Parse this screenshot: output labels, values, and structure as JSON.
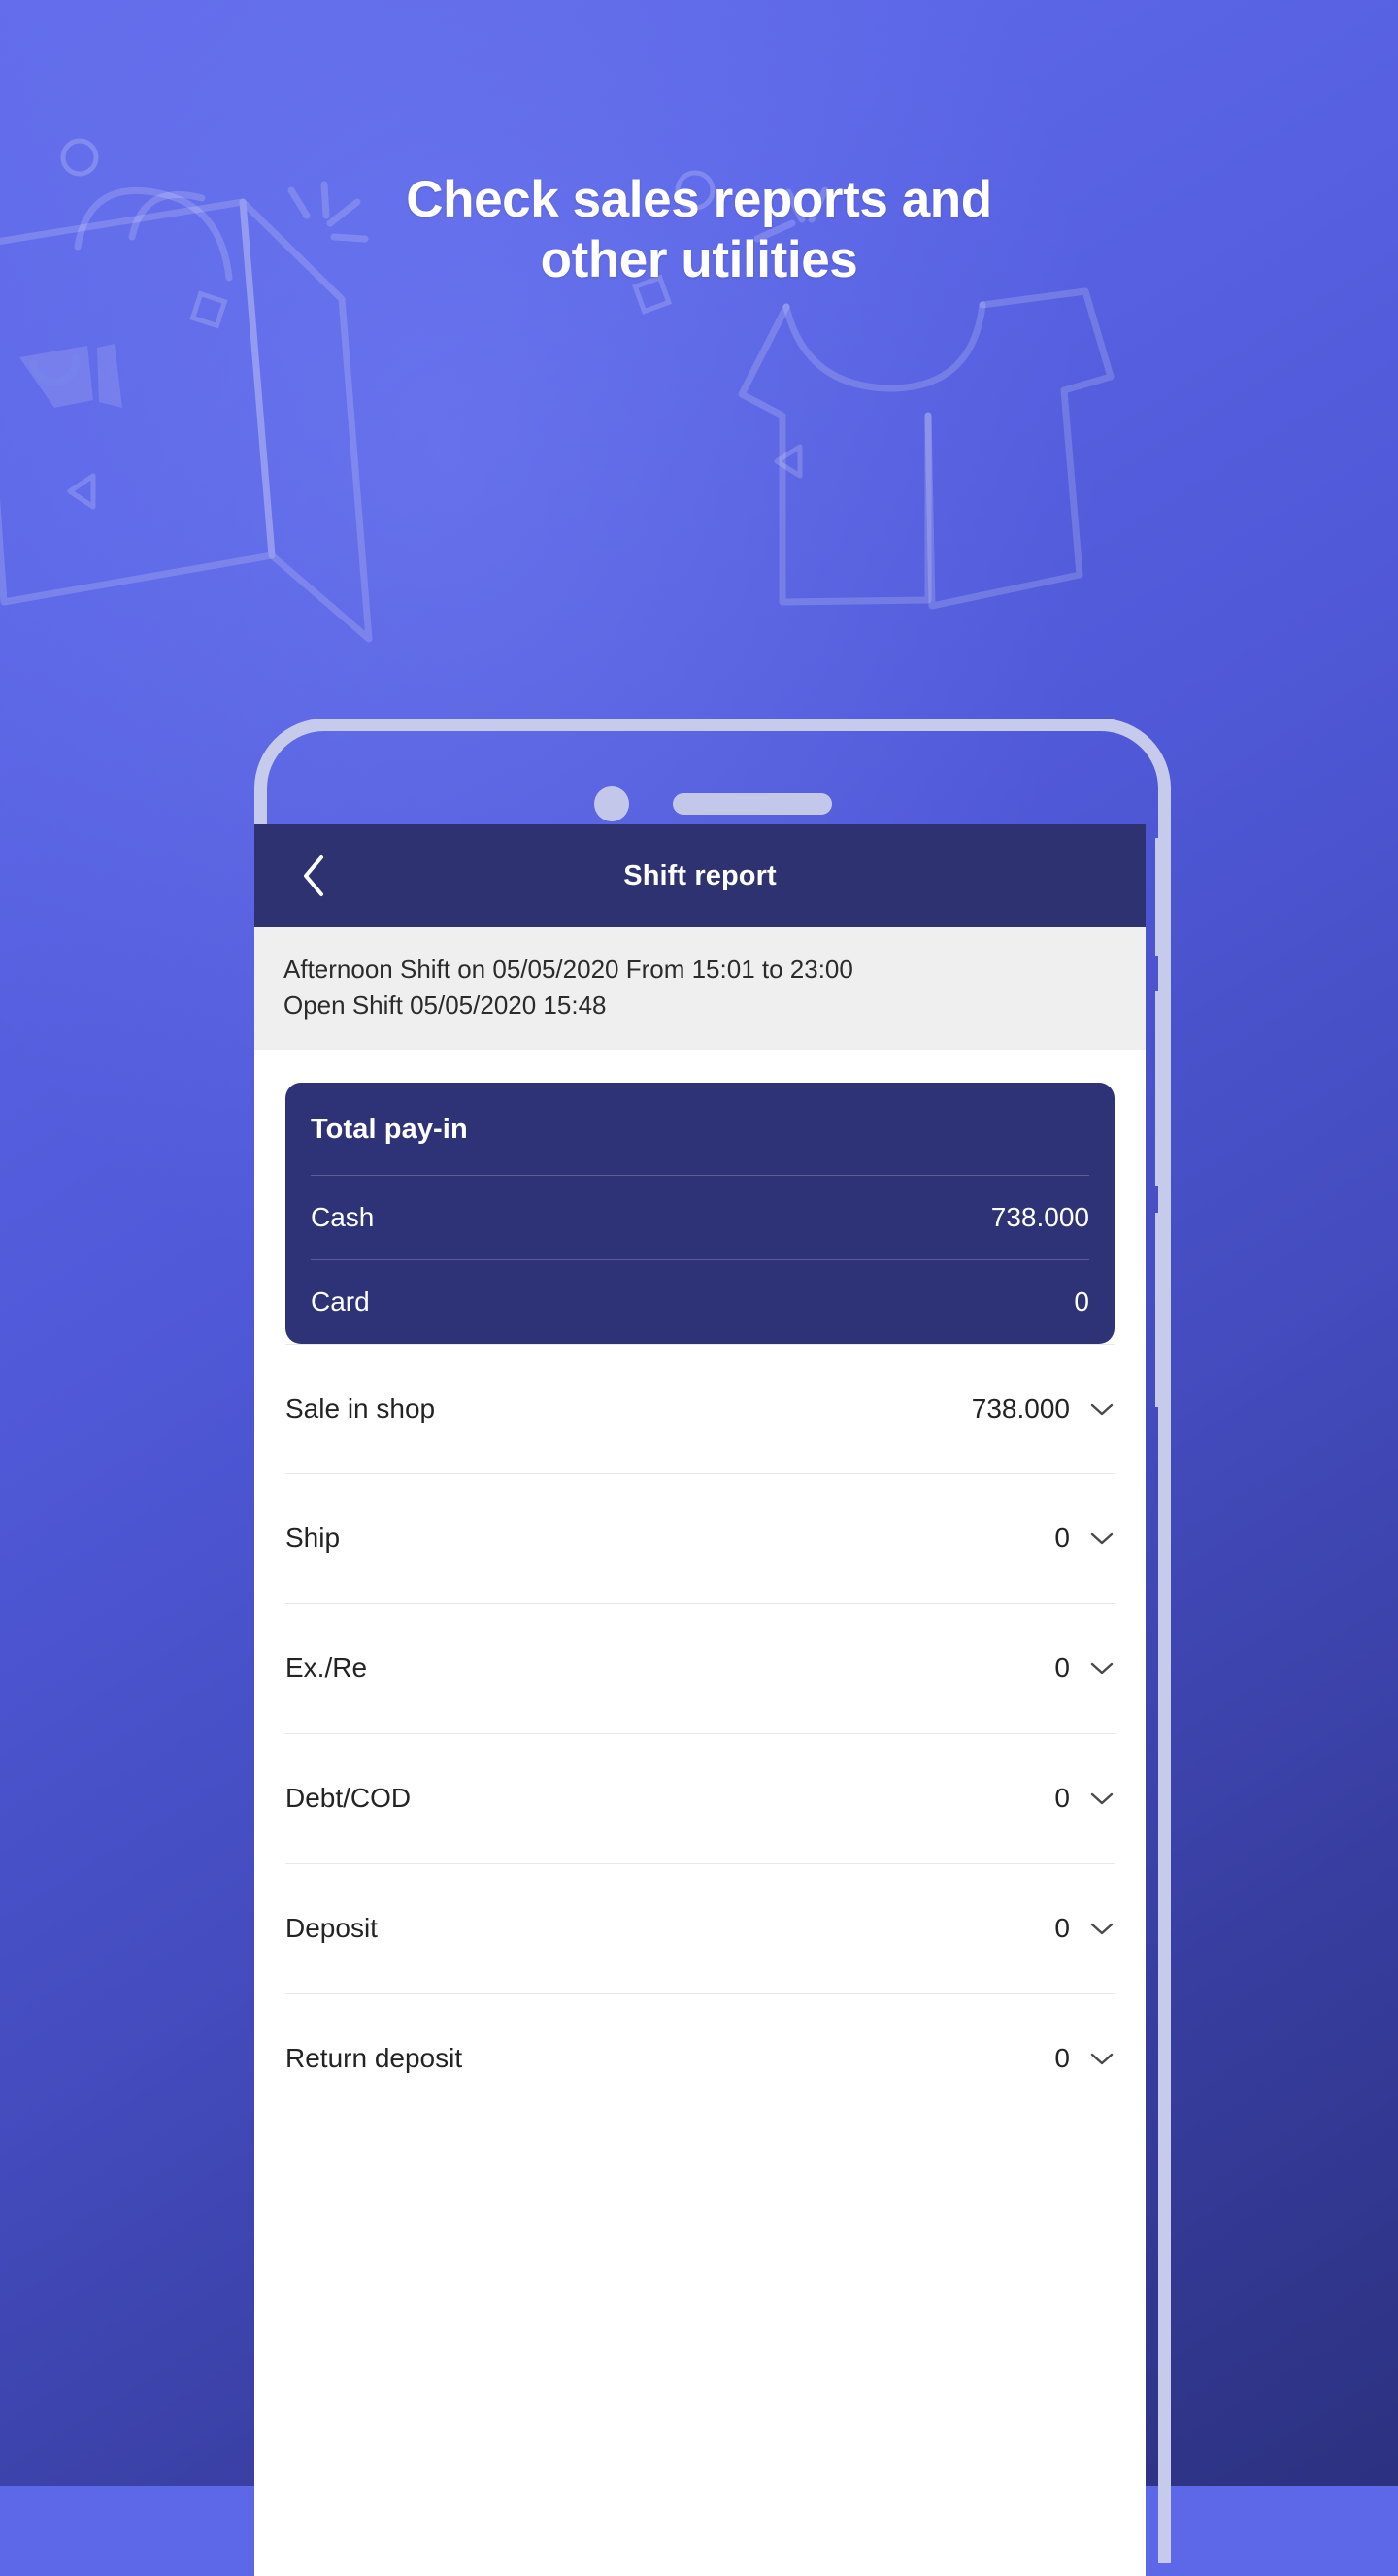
{
  "hero": {
    "headline_line1": "Check sales reports and",
    "headline_line2": "other utilities"
  },
  "colors": {
    "bg_top": "#626ceb",
    "bg_bottom": "#2c3180",
    "phone_frame": "#c6cbec",
    "app_header": "#2e3270",
    "card_navy": "#2e3378",
    "banner_gray": "#efefef",
    "text_dark": "#232323",
    "white": "#ffffff"
  },
  "phone": {
    "camera_icon": "camera-dot-icon",
    "speaker_icon": "speaker-grille-icon",
    "side_buttons": [
      "silent-switch",
      "volume-up-button",
      "volume-down-button"
    ]
  },
  "decorations": [
    "shopping-bag-outline",
    "tshirt-outline",
    "sparkle-lines",
    "circle-outline",
    "diamond-outline",
    "triangle-outline"
  ],
  "app": {
    "header": {
      "back_icon": "chevron-left-icon",
      "title": "Shift report"
    },
    "shift_banner": {
      "line1": "Afternoon Shift on 05/05/2020 From 15:01 to 23:00",
      "line2": "Open Shift 05/05/2020 15:48"
    },
    "payin_card": {
      "title": "Total pay-in",
      "rows": [
        {
          "label": "Cash",
          "value": "738.000"
        },
        {
          "label": "Card",
          "value": "0"
        }
      ]
    },
    "report_rows": [
      {
        "label": "Sale in shop",
        "value": "738.000",
        "icon": "chevron-down-icon"
      },
      {
        "label": "Ship",
        "value": "0",
        "icon": "chevron-down-icon"
      },
      {
        "label": "Ex./Re",
        "value": "0",
        "icon": "chevron-down-icon"
      },
      {
        "label": "Debt/COD",
        "value": "0",
        "icon": "chevron-down-icon"
      },
      {
        "label": "Deposit",
        "value": "0",
        "icon": "chevron-down-icon"
      },
      {
        "label": "Return deposit",
        "value": "0",
        "icon": "chevron-down-icon"
      }
    ]
  }
}
